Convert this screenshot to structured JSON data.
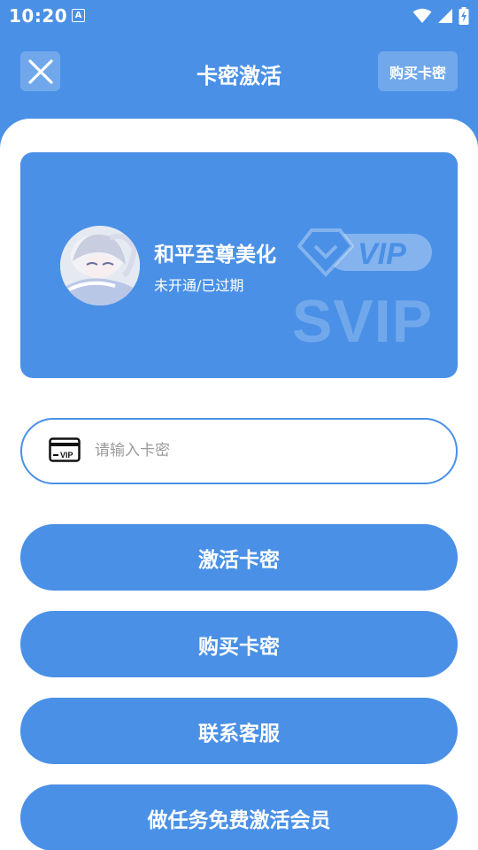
{
  "status_bar": {
    "time": "10:20",
    "app_icon_letter": "A",
    "icons": [
      "wifi-icon",
      "signal-icon",
      "battery-icon"
    ]
  },
  "header": {
    "title": "卡密激活",
    "close_icon": "close-icon",
    "buy_button_label": "购买卡密"
  },
  "vip_card": {
    "user_name": "和平至尊美化",
    "status": "未开通/已过期",
    "badge_text": "VIP",
    "watermark_text": "SVIP"
  },
  "card_input": {
    "placeholder": "请输入卡密",
    "value": "",
    "icon": "vip-card-icon",
    "icon_text": "VIP"
  },
  "buttons": {
    "activate": "激活卡密",
    "buy": "购买卡密",
    "contact": "联系客服",
    "task": "做任务免费激活会员"
  },
  "colors": {
    "primary": "#4a90e6",
    "surface": "#ffffff"
  }
}
